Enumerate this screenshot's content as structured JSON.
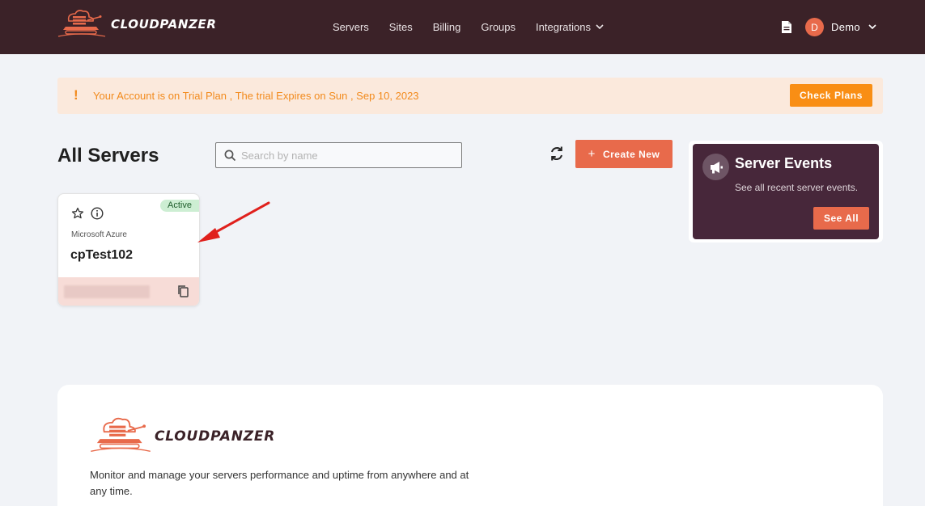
{
  "app": {
    "brand": "CLOUDPANZER"
  },
  "nav": {
    "items": [
      "Servers",
      "Sites",
      "Billing",
      "Groups"
    ],
    "integrations": "Integrations"
  },
  "user": {
    "initial": "D",
    "name": "Demo"
  },
  "banner": {
    "icon": "!",
    "text": "Your Account is on Trial Plan , The trial Expires on Sun , Sep 10, 2023",
    "button": "Check Plans"
  },
  "servers": {
    "title": "All Servers",
    "search_placeholder": "Search by name",
    "create_label": "Create New",
    "create_icon": "+"
  },
  "card": {
    "status": "Active",
    "provider": "Microsoft Azure",
    "name": "cpTest102"
  },
  "events": {
    "title": "Server Events",
    "subtitle": "See all recent server events.",
    "button": "See All"
  },
  "footer": {
    "brand": "CLOUDPANZER",
    "description": "Monitor and manage your servers performance and uptime from anywhere and at any time."
  },
  "colors": {
    "header_bg": "#3b2228",
    "accent": "#e86a4b",
    "banner_text": "#f28a1c",
    "check_plans": "#f98e14",
    "events_bg": "#47273a",
    "active_badge": "#cdeed3",
    "annotation_arrow": "#e0201c"
  },
  "icons": {
    "logo": "tank-cloud-logo",
    "document": "document-icon",
    "refresh": "refresh-icon",
    "star": "star-icon",
    "info": "info-icon",
    "copy": "copy-icon",
    "megaphone": "megaphone-icon",
    "search": "search-icon",
    "chevron": "chevron-down-icon"
  }
}
